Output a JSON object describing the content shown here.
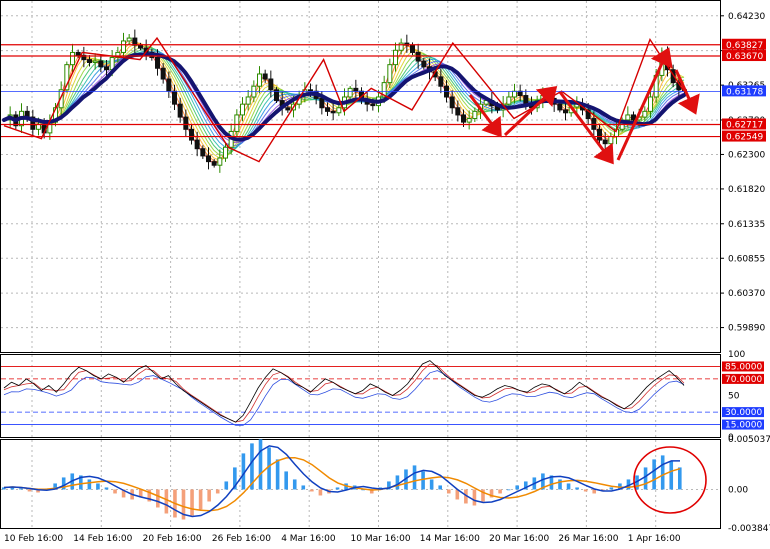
{
  "chart_data": [
    {
      "type": "candlestick",
      "title": "",
      "ylim": [
        0.5955,
        0.6445
      ],
      "y_ticks": [
        "0.64230",
        "0.63745",
        "0.63265",
        "0.62780",
        "0.62300",
        "0.61820",
        "0.61335",
        "0.60855",
        "0.60370",
        "0.59890"
      ],
      "levels": [
        {
          "label": "0.63827",
          "value": 0.63827,
          "color": "#e00000"
        },
        {
          "label": "0.63670",
          "value": 0.6367,
          "color": "#e00000"
        },
        {
          "label": "0.63178",
          "value": 0.63178,
          "color": "#1e3cff"
        },
        {
          "label": "0.62717",
          "value": 0.62717,
          "color": "#e00000"
        },
        {
          "label": "0.62549",
          "value": 0.62549,
          "color": "#e00000"
        }
      ],
      "price_path": [
        0.6278,
        0.6285,
        0.627,
        0.629,
        0.6282,
        0.6265,
        0.6272,
        0.626,
        0.6275,
        0.6295,
        0.632,
        0.6355,
        0.6372,
        0.6368,
        0.6362,
        0.6358,
        0.636,
        0.6352,
        0.6348,
        0.6365,
        0.6372,
        0.6388,
        0.6392,
        0.6382,
        0.6378,
        0.6372,
        0.6365,
        0.635,
        0.6335,
        0.6318,
        0.63,
        0.6282,
        0.6265,
        0.625,
        0.6238,
        0.6228,
        0.622,
        0.6215,
        0.6225,
        0.624,
        0.6262,
        0.6285,
        0.63,
        0.631,
        0.6325,
        0.6342,
        0.6335,
        0.632,
        0.6305,
        0.6295,
        0.6292,
        0.63,
        0.6312,
        0.632,
        0.6318,
        0.6308,
        0.6295,
        0.629,
        0.6288,
        0.6295,
        0.631,
        0.6322,
        0.6318,
        0.6305,
        0.63,
        0.6298,
        0.631,
        0.633,
        0.6355,
        0.6375,
        0.6385,
        0.6382,
        0.6372,
        0.636,
        0.6352,
        0.6345,
        0.6338,
        0.6325,
        0.631,
        0.6295,
        0.6285,
        0.6275,
        0.628,
        0.629,
        0.63,
        0.6305,
        0.6298,
        0.6292,
        0.63,
        0.631,
        0.6318,
        0.6312,
        0.63,
        0.6295,
        0.6305,
        0.6312,
        0.6308,
        0.63,
        0.6292,
        0.6288,
        0.6296,
        0.63,
        0.6292,
        0.628,
        0.6265,
        0.625,
        0.6245,
        0.6255,
        0.6265,
        0.6278,
        0.6285,
        0.6278,
        0.6282,
        0.629,
        0.631,
        0.634,
        0.637,
        0.6348,
        0.633,
        0.632,
        0.6318
      ],
      "zigzag": [
        [
          0.0,
          0.627
        ],
        [
          0.055,
          0.6252
        ],
        [
          0.115,
          0.6372
        ],
        [
          0.2,
          0.6362
        ],
        [
          0.225,
          0.6392
        ],
        [
          0.33,
          0.624
        ],
        [
          0.375,
          0.622
        ],
        [
          0.47,
          0.6362
        ],
        [
          0.5,
          0.629
        ],
        [
          0.54,
          0.6322
        ],
        [
          0.6,
          0.6292
        ],
        [
          0.66,
          0.6385
        ],
        [
          0.75,
          0.628
        ],
        [
          0.82,
          0.6318
        ],
        [
          0.9,
          0.6262
        ],
        [
          0.95,
          0.639
        ],
        [
          1.0,
          0.6318
        ]
      ],
      "arrows": [
        {
          "from": [
            0.0,
            0.6385
          ],
          "to": [
            0.07,
            0.627
          ]
        },
        {
          "from": [
            0.09,
            0.628
          ],
          "to": [
            0.15,
            0.632
          ]
        },
        {
          "from": [
            0.18,
            0.631
          ],
          "to": [
            0.24,
            0.624
          ]
        },
        {
          "from": [
            0.27,
            0.624
          ],
          "to": [
            0.34,
            0.6385
          ]
        },
        {
          "from": [
            0.35,
            0.637
          ],
          "to": [
            0.38,
            0.6298
          ]
        }
      ]
    },
    {
      "type": "line",
      "title": "",
      "ylim": [
        0,
        100
      ],
      "y_ticks": [
        "100",
        "50",
        "0"
      ],
      "levels": [
        {
          "label": "85.0000",
          "value": 85,
          "color": "#e00000"
        },
        {
          "label": "70.0000",
          "value": 70,
          "color": "#e00000"
        },
        {
          "label": "30.0000",
          "value": 30,
          "color": "#1e3cff"
        },
        {
          "label": "15.0000",
          "value": 15,
          "color": "#1e3cff"
        }
      ],
      "series_shape": [
        55,
        62,
        58,
        66,
        60,
        52,
        58,
        50,
        60,
        72,
        80,
        76,
        70,
        66,
        72,
        68,
        62,
        70,
        78,
        82,
        74,
        66,
        70,
        60,
        52,
        46,
        40,
        34,
        28,
        22,
        18,
        14,
        22,
        38,
        55,
        68,
        78,
        74,
        68,
        60,
        56,
        50,
        58,
        66,
        62,
        56,
        52,
        48,
        52,
        60,
        56,
        50,
        46,
        52,
        60,
        72,
        84,
        88,
        80,
        70,
        64,
        58,
        52,
        46,
        44,
        48,
        54,
        58,
        56,
        52,
        50,
        56,
        60,
        58,
        52,
        48,
        54,
        62,
        56,
        50,
        44,
        40,
        34,
        30,
        36,
        46,
        56,
        64,
        70,
        76,
        68,
        58
      ]
    },
    {
      "type": "bar",
      "title": "",
      "ylim": [
        -0.0038477,
        0.0050374
      ],
      "y_ticks": [
        "0.005037",
        "0.00",
        "-0.003847"
      ],
      "series_shape": [
        0.0002,
        0.0003,
        0.0001,
        -0.0002,
        -0.0003,
        0.0001,
        0.0006,
        0.0012,
        0.0016,
        0.0014,
        0.001,
        0.0006,
        0.0002,
        -0.0004,
        -0.0008,
        -0.001,
        -0.0008,
        -0.0012,
        -0.0018,
        -0.0024,
        -0.0028,
        -0.003,
        -0.0026,
        -0.002,
        -0.0012,
        -0.0004,
        0.0008,
        0.0022,
        0.0036,
        0.0046,
        0.005,
        0.0042,
        0.003,
        0.0018,
        0.001,
        0.0004,
        -0.0002,
        -0.0006,
        -0.0004,
        0.0002,
        0.0006,
        0.0004,
        0.0,
        -0.0004,
        0.0002,
        0.0008,
        0.0014,
        0.002,
        0.0024,
        0.0018,
        0.001,
        0.0004,
        -0.0004,
        -0.001,
        -0.0014,
        -0.0016,
        -0.0012,
        -0.0008,
        -0.0004,
        0.0,
        0.0004,
        0.0008,
        0.0012,
        0.0016,
        0.0014,
        0.001,
        0.0006,
        0.0002,
        -0.0002,
        -0.0004,
        -0.0002,
        0.0002,
        0.0006,
        0.001,
        0.0014,
        0.0022,
        0.003,
        0.0034,
        0.0028,
        0.0022
      ]
    }
  ],
  "x_axis": {
    "labels": [
      "10 Feb 16:00",
      "14 Feb 16:00",
      "20 Feb 16:00",
      "26 Feb 16:00",
      "4 Mar 16:00",
      "10 Mar 16:00",
      "14 Mar 16:00",
      "20 Mar 16:00",
      "26 Mar 16:00",
      "1 Apr 16:00"
    ]
  },
  "colors": {
    "bull": "#2e8b00",
    "bear": "#111111",
    "zigzag": "#d40000",
    "arrow": "#e01010",
    "ma_thick": "#141470",
    "stoch_main": "#000000",
    "stoch_signal": "#d03030",
    "stoch_alt": "#3050e0",
    "macd_pos": "#3399ee",
    "macd_neg": "#f4a07a",
    "macd_line": "#1040c0",
    "signal_line": "#f08a00",
    "level_label_bg": "#e00000",
    "level_label_blue_bg": "#1e3cff",
    "grid": "#b8b8b8",
    "circle": "#e00000"
  }
}
